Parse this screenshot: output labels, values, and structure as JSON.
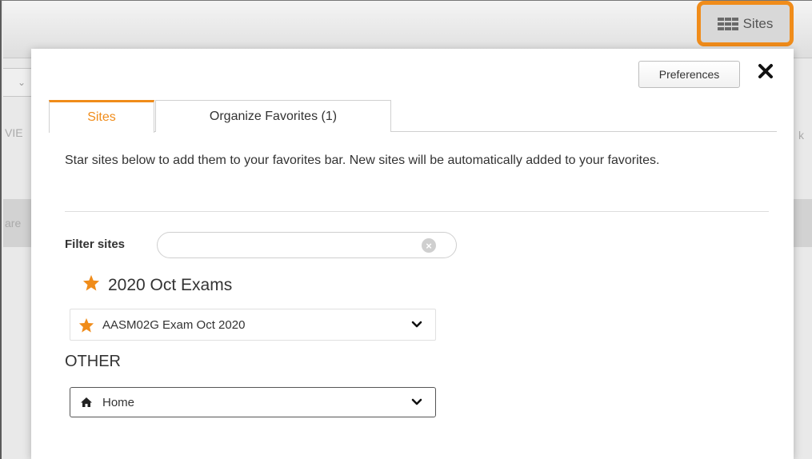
{
  "background": {
    "fragments": [
      "VIE",
      "k",
      "are"
    ]
  },
  "header": {
    "sites_button_label": "Sites",
    "accent_color": "#f08c1a"
  },
  "panel": {
    "preferences_label": "Preferences",
    "close_icon": "close-icon",
    "tabs": [
      {
        "label": "Sites",
        "active": true
      },
      {
        "label": "Organize Favorites (1)",
        "active": false
      }
    ],
    "intro_text": "Star sites below to add them to your favorites bar. New sites will be automatically added to your favorites.",
    "filter": {
      "label": "Filter sites",
      "value": "",
      "placeholder": ""
    },
    "groups": [
      {
        "title": "2020 Oct Exams",
        "starred": true,
        "sites": [
          {
            "name": "AASM02G Exam Oct 2020",
            "starred": true,
            "icon": "star-icon"
          }
        ]
      }
    ],
    "other": {
      "title": "OTHER",
      "sites": [
        {
          "name": "Home",
          "icon": "home-icon"
        }
      ]
    }
  }
}
